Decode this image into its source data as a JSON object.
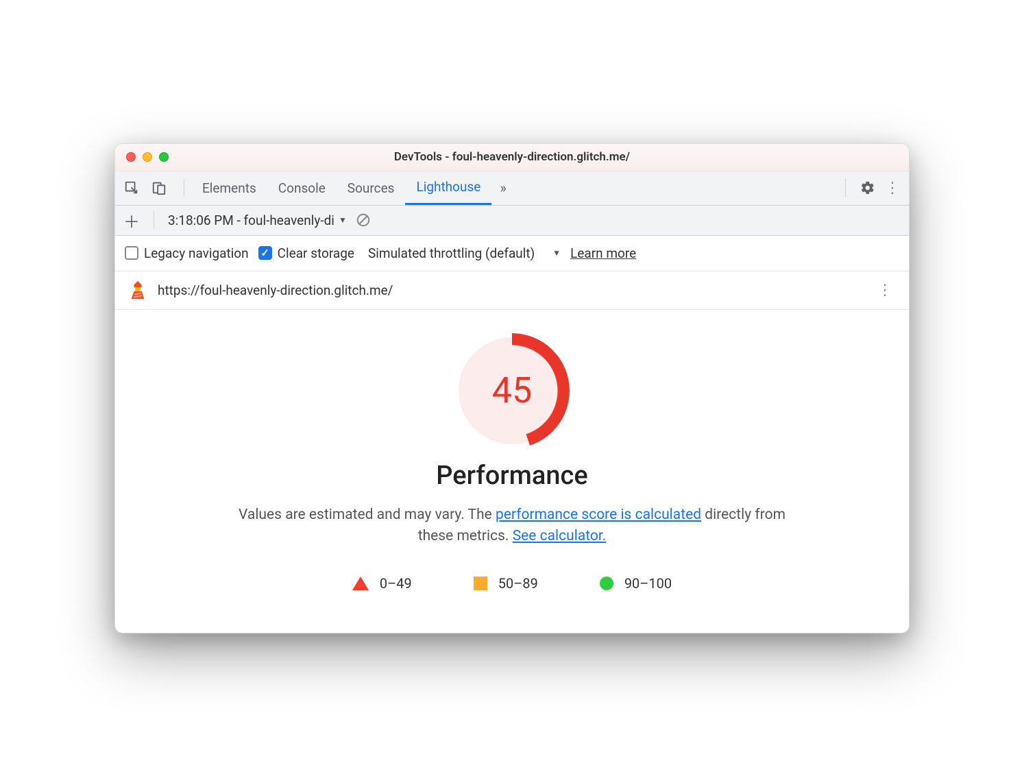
{
  "window": {
    "title": "DevTools - foul-heavenly-direction.glitch.me/"
  },
  "tabs": {
    "items": [
      "Elements",
      "Console",
      "Sources",
      "Lighthouse"
    ],
    "active_index": 3
  },
  "subbar": {
    "report_label": "3:18:06 PM - foul-heavenly-di"
  },
  "options": {
    "legacy_label": "Legacy navigation",
    "legacy_checked": false,
    "clear_label": "Clear storage",
    "clear_checked": true,
    "throttling_label": "Simulated throttling (default)",
    "learn_more": "Learn more"
  },
  "url": "https://foul-heavenly-direction.glitch.me/",
  "report": {
    "score": "45",
    "title": "Performance",
    "desc_prefix": "Values are estimated and may vary. The ",
    "link1": "performance score is calculated",
    "desc_mid": " directly from these metrics. ",
    "link2": "See calculator.",
    "legend": {
      "fail": "0–49",
      "avg": "50–89",
      "pass": "90–100"
    }
  }
}
